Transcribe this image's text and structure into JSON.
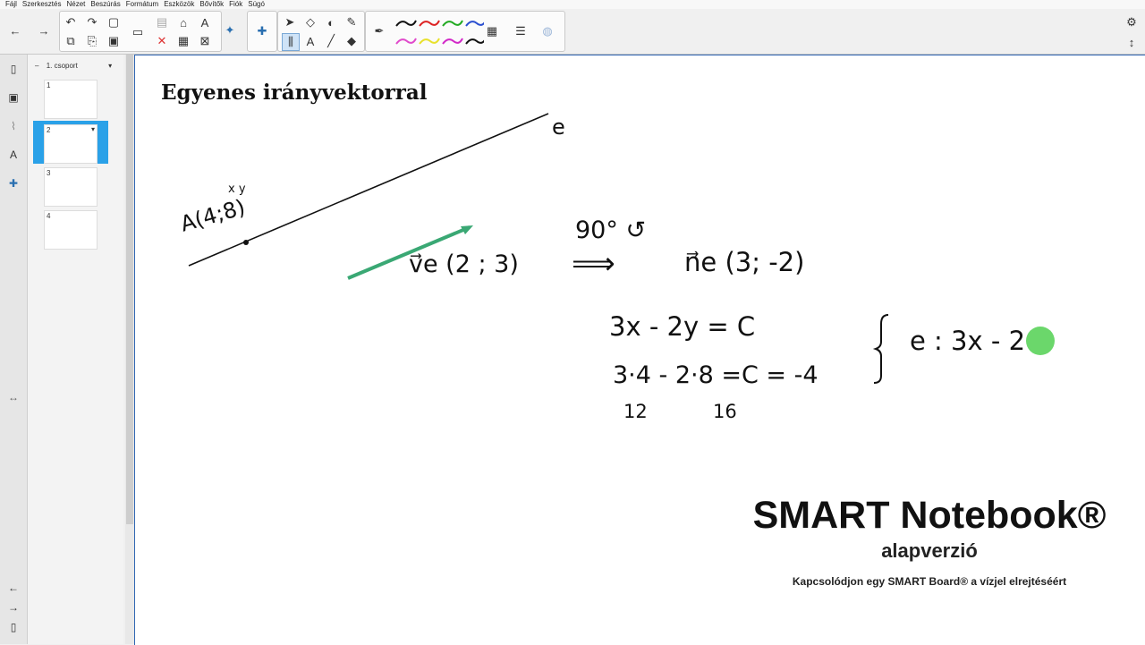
{
  "menu": [
    "Fájl",
    "Szerkesztés",
    "Nézet",
    "Beszúrás",
    "Formátum",
    "Eszközök",
    "Bővítők",
    "Fiók",
    "Súgó"
  ],
  "sidebar": {
    "group_label": "1. csoport",
    "pages": [
      "1",
      "2",
      "3",
      "4"
    ],
    "selected_page": "2"
  },
  "page": {
    "title": "Egyenes irányvektorral",
    "handwriting": {
      "line_label": "e",
      "point": "A(4;8)",
      "point_xy": "x   y",
      "direction_vector": "v⃗e (2 ; 3)",
      "rotation": "90° ↺",
      "arrow": "⟹",
      "normal_vector": "n⃗e  (3;  -2)",
      "eq1": "3x - 2y = C",
      "eq2": "3·4  -  2·8   =C  =  -4",
      "calc1": "12",
      "calc2": "16",
      "result": "e : 3x - 2"
    }
  },
  "brand": {
    "title": "SMART Notebook®",
    "subtitle": "alapverzió",
    "note": "Kapcsolódjon egy SMART Board® a vízjel elrejtéséért"
  },
  "colors": {
    "accent": "#2aa1e8",
    "vector_green": "#3aa874",
    "pointer": "#5bd35b"
  },
  "icons": [
    "back-icon",
    "forward-icon",
    "undo-icon",
    "redo-icon",
    "new-page-icon",
    "delete-icon",
    "table-icon",
    "screen-shade-icon",
    "select-icon",
    "shapes-icon",
    "fill-icon",
    "text-icon",
    "line-icon",
    "eraser-icon",
    "pen-icon",
    "color-picker-icon",
    "gear-icon"
  ]
}
